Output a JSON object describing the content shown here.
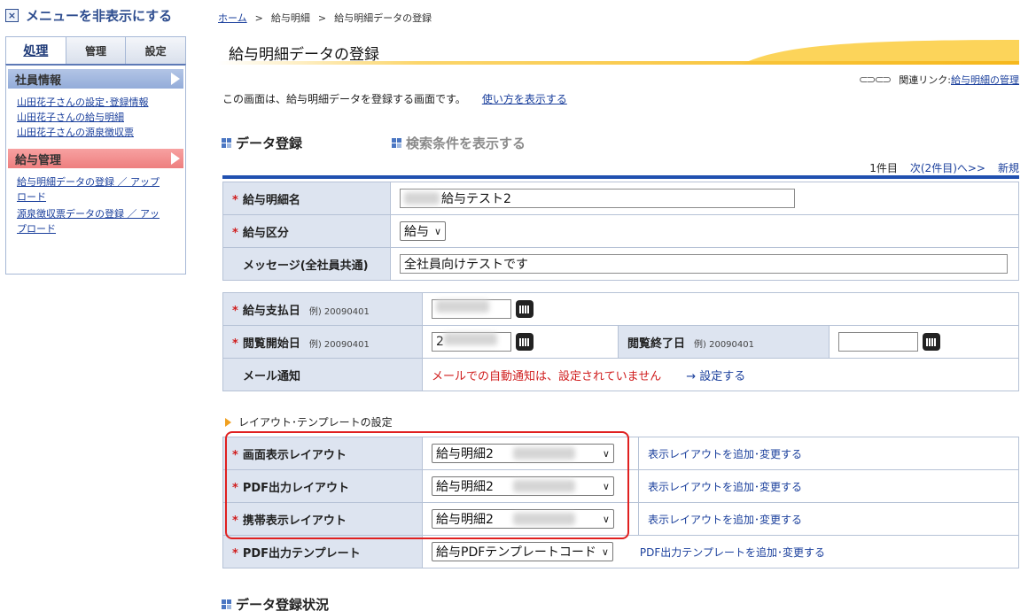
{
  "sidebar": {
    "hide_menu_label": "メニューを非表示にする",
    "tabs": [
      "処理",
      "管理",
      "設定"
    ],
    "section_employee": {
      "title": "社員情報",
      "links": [
        "山田花子さんの設定･登録情報",
        "山田花子さんの給与明細",
        "山田花子さんの源泉徴収票"
      ]
    },
    "section_payroll": {
      "title": "給与管理",
      "links": [
        "給与明細データの登録 ／ アップロード",
        "源泉徴収票データの登録 ／ アップロード"
      ]
    }
  },
  "breadcrumb": [
    "ホーム",
    "給与明細",
    "給与明細データの登録"
  ],
  "page_title": "給与明細データの登録",
  "related": {
    "prefix": "関連リンク:",
    "link": "給与明細の管理"
  },
  "intro": {
    "text": "この画面は、給与明細データを登録する画面です。",
    "link": "使い方を表示する"
  },
  "section_data_entry": "データ登録",
  "section_search": "検索条件を表示する",
  "pager": {
    "count": "1件目",
    "next": "次(2件目)へ>>",
    "new": "新規"
  },
  "form1": {
    "name_label": "給与明細名",
    "name_value": "給与テスト2",
    "type_label": "給与区分",
    "type_value": "給与",
    "message_label": "メッセージ(全社員共通)",
    "message_value": "全社員向けテストです"
  },
  "form2": {
    "pay_date_label": "給与支払日",
    "example": "例) 20090401",
    "view_start_label": "閲覧開始日",
    "view_start_value": "2",
    "view_end_label": "閲覧終了日",
    "mail_label": "メール通知",
    "mail_notice": "メールでの自動通知は、設定されていません",
    "mail_link": "→ 設定する"
  },
  "layout_section_title": "レイアウト･テンプレートの設定",
  "form3": {
    "rows": [
      {
        "label": "画面表示レイアウト",
        "value": "給与明細2",
        "link": "表示レイアウトを追加･変更する"
      },
      {
        "label": "PDF出力レイアウト",
        "value": "給与明細2",
        "link": "表示レイアウトを追加･変更する"
      },
      {
        "label": "携帯表示レイアウト",
        "value": "給与明細2",
        "link": "表示レイアウトを追加･変更する"
      },
      {
        "label": "PDF出力テンプレート",
        "value": "給与PDFテンプレートコード",
        "link": "PDF出力テンプレートを追加･変更する"
      }
    ]
  },
  "section_status": "データ登録状況"
}
